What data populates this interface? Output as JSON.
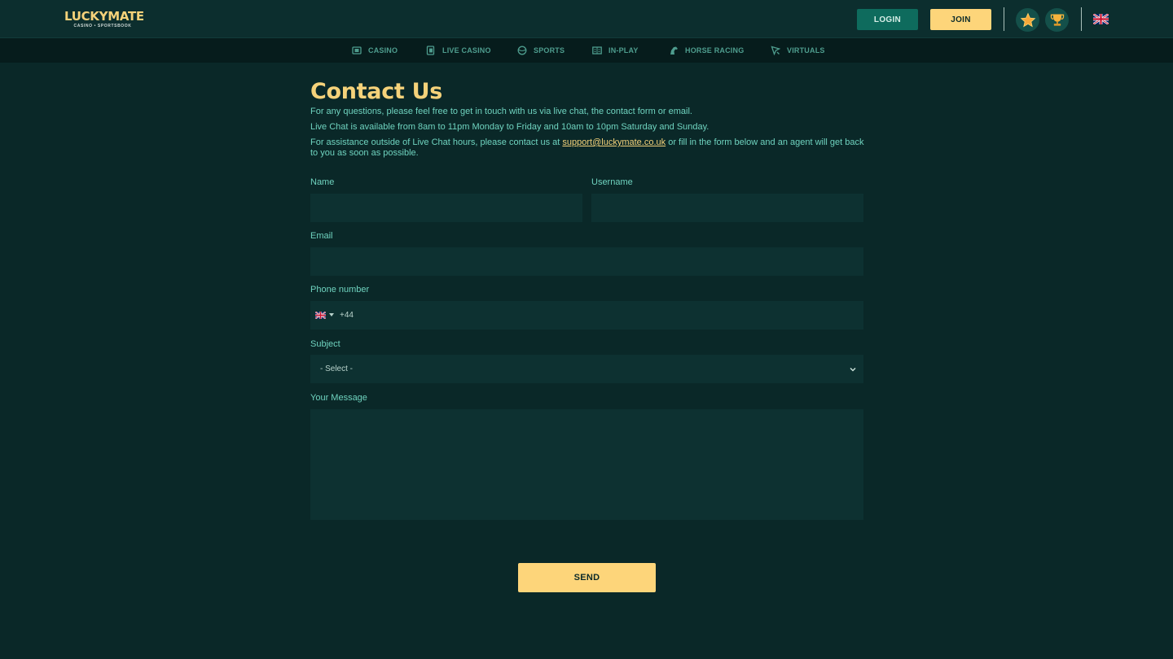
{
  "header": {
    "logo_part1": "LUCKY",
    "logo_part2": "MATE",
    "logo_tagline": "CASINO • SPORTSBOOK",
    "login_label": "LOGIN",
    "join_label": "JOIN",
    "icons": [
      "star-icon",
      "trophy-icon",
      "uk-flag-icon"
    ]
  },
  "nav": {
    "items": [
      {
        "label": "CASINO",
        "icon": "casino-chip-icon"
      },
      {
        "label": "LIVE CASINO",
        "icon": "cards-icon"
      },
      {
        "label": "SPORTS",
        "icon": "ball-icon"
      },
      {
        "label": "IN-PLAY",
        "icon": "scoreboard-icon"
      },
      {
        "label": "HORSE RACING",
        "icon": "horse-icon"
      },
      {
        "label": "VIRTUALS",
        "icon": "virtuals-icon"
      }
    ]
  },
  "page": {
    "title": "Contact Us",
    "intro1": "For any questions, please feel free to get in touch with us via live chat, the contact form or email.",
    "intro2": "Live Chat is available from 8am to 11pm Monday to Friday and 10am to 10pm Saturday and Sunday.",
    "intro3_before": "For assistance outside of Live Chat hours, please contact us at ",
    "support_email": "support@luckymate.co.uk",
    "intro3_after": " or fill in the form below and an agent will get back to you as soon as possible."
  },
  "form": {
    "name_label": "Name",
    "username_label": "Username",
    "email_label": "Email",
    "phone_label": "Phone number",
    "phone_prefix": "+44",
    "subject_label": "Subject",
    "subject_selected": "- Select -",
    "message_label": "Your Message",
    "send_label": "SEND"
  },
  "colors": {
    "background": "#0a2828",
    "accent_yellow": "#fdd57a",
    "accent_teal": "#0e6b5d",
    "text_teal": "#6fd3bf"
  }
}
